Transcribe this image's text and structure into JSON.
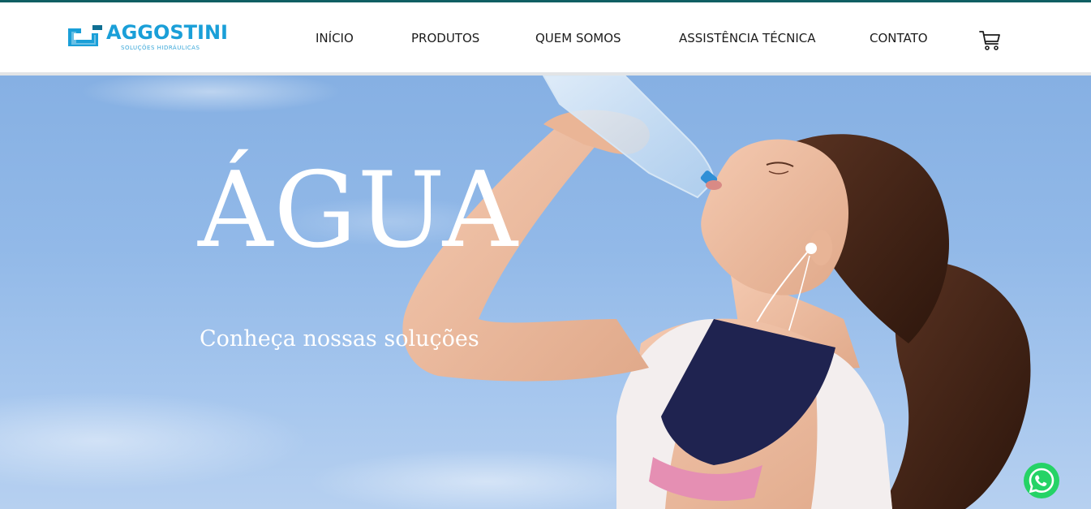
{
  "brand": {
    "name": "AGGOSTINI",
    "tagline": "SOLUÇÕES HIDRÁULICAS",
    "color": "#1a9fd8"
  },
  "nav": {
    "items": [
      {
        "label": "INÍCIO"
      },
      {
        "label": "PRODUTOS"
      },
      {
        "label": "QUEM SOMOS"
      },
      {
        "label": "ASSISTÊNCIA TÉCNICA"
      },
      {
        "label": "CONTATO"
      }
    ],
    "cart_icon": "shopping-cart-icon"
  },
  "hero": {
    "title": "ÁGUA",
    "subtitle": "Conheça nossas soluções",
    "image": "woman-drinking-water-bottle"
  },
  "floating": {
    "whatsapp_icon": "whatsapp-icon",
    "whatsapp_color": "#25d366"
  },
  "colors": {
    "top_accent": "#0f5f63",
    "sky": "#8fb6e6"
  }
}
